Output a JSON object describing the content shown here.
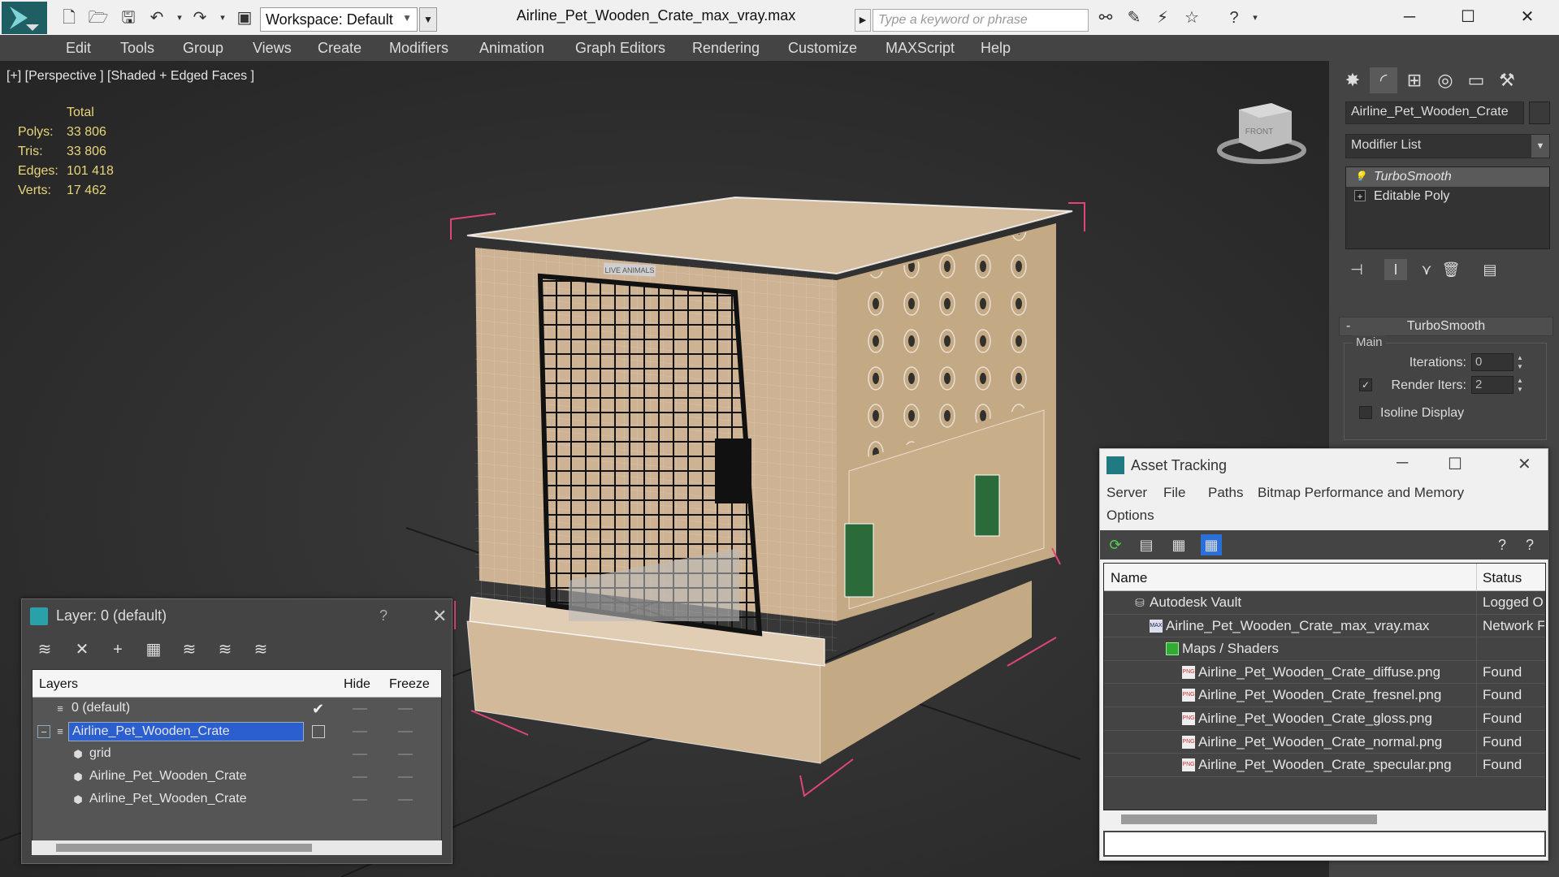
{
  "window": {
    "title": "Airline_Pet_Wooden_Crate_max_vray.max",
    "workspace": "Workspace: Default",
    "search_placeholder": "Type a keyword or phrase"
  },
  "menu": [
    "Edit",
    "Tools",
    "Group",
    "Views",
    "Create",
    "Modifiers",
    "Animation",
    "Graph Editors",
    "Rendering",
    "Customize",
    "MAXScript",
    "Help"
  ],
  "viewport": {
    "label": "[+] [Perspective ] [Shaded + Edged Faces ]",
    "stats": {
      "header": "Total",
      "rows": [
        {
          "key": "Polys:",
          "value": "33 806"
        },
        {
          "key": "Tris:",
          "value": "33 806"
        },
        {
          "key": "Edges:",
          "value": "101 418"
        },
        {
          "key": "Verts:",
          "value": "17 462"
        }
      ]
    },
    "crate_label": "LIVE ANIMALS",
    "viewcube_label": "FRONT"
  },
  "command_panel": {
    "object_name": "Airline_Pet_Wooden_Crate",
    "modifier_list": "Modifier List",
    "stack": [
      {
        "label": "TurboSmooth",
        "selected": true
      },
      {
        "label": "Editable Poly",
        "selected": false
      }
    ],
    "rollout": {
      "title": "TurboSmooth",
      "group": "Main",
      "iterations_label": "Iterations:",
      "iterations": "0",
      "render_iters_label": "Render Iters:",
      "render_iters": "2",
      "render_iters_checked": true,
      "isoline_label": "Isoline Display",
      "isoline_checked": false
    }
  },
  "layer_window": {
    "title": "Layer: 0 (default)",
    "help": "?",
    "columns": {
      "layers": "Layers",
      "hide": "Hide",
      "freeze": "Freeze"
    },
    "rows": [
      {
        "label": "0 (default)",
        "indent": 0,
        "type": "layer",
        "current": true
      },
      {
        "label": "Airline_Pet_Wooden_Crate",
        "indent": 0,
        "type": "layer",
        "selected": true
      },
      {
        "label": "grid",
        "indent": 1,
        "type": "object"
      },
      {
        "label": "Airline_Pet_Wooden_Crate",
        "indent": 1,
        "type": "object"
      },
      {
        "label": "Airline_Pet_Wooden_Crate",
        "indent": 1,
        "type": "object"
      }
    ]
  },
  "asset_window": {
    "title": "Asset Tracking",
    "menu": [
      "Server",
      "File",
      "Paths",
      "Bitmap Performance and Memory",
      "Options"
    ],
    "columns": {
      "name": "Name",
      "status": "Status"
    },
    "rows": [
      {
        "name": "Autodesk Vault",
        "status": "Logged O",
        "indent": 1,
        "icon": "vault-icon"
      },
      {
        "name": "Airline_Pet_Wooden_Crate_max_vray.max",
        "status": "Network F",
        "indent": 2,
        "icon": "max-file-icon"
      },
      {
        "name": "Maps / Shaders",
        "status": "",
        "indent": 3,
        "icon": "maps-folder-icon"
      },
      {
        "name": "Airline_Pet_Wooden_Crate_diffuse.png",
        "status": "Found",
        "indent": 4,
        "icon": "png-icon"
      },
      {
        "name": "Airline_Pet_Wooden_Crate_fresnel.png",
        "status": "Found",
        "indent": 4,
        "icon": "png-icon"
      },
      {
        "name": "Airline_Pet_Wooden_Crate_gloss.png",
        "status": "Found",
        "indent": 4,
        "icon": "png-icon"
      },
      {
        "name": "Airline_Pet_Wooden_Crate_normal.png",
        "status": "Found",
        "indent": 4,
        "icon": "png-icon"
      },
      {
        "name": "Airline_Pet_Wooden_Crate_specular.png",
        "status": "Found",
        "indent": 4,
        "icon": "png-icon"
      }
    ],
    "png_badge": "PNG",
    "max_badge": "MAX"
  },
  "colors": {
    "accent": "#2b5fd0",
    "stats_text": "#e8d57a",
    "selection_box": "#e0457a"
  }
}
